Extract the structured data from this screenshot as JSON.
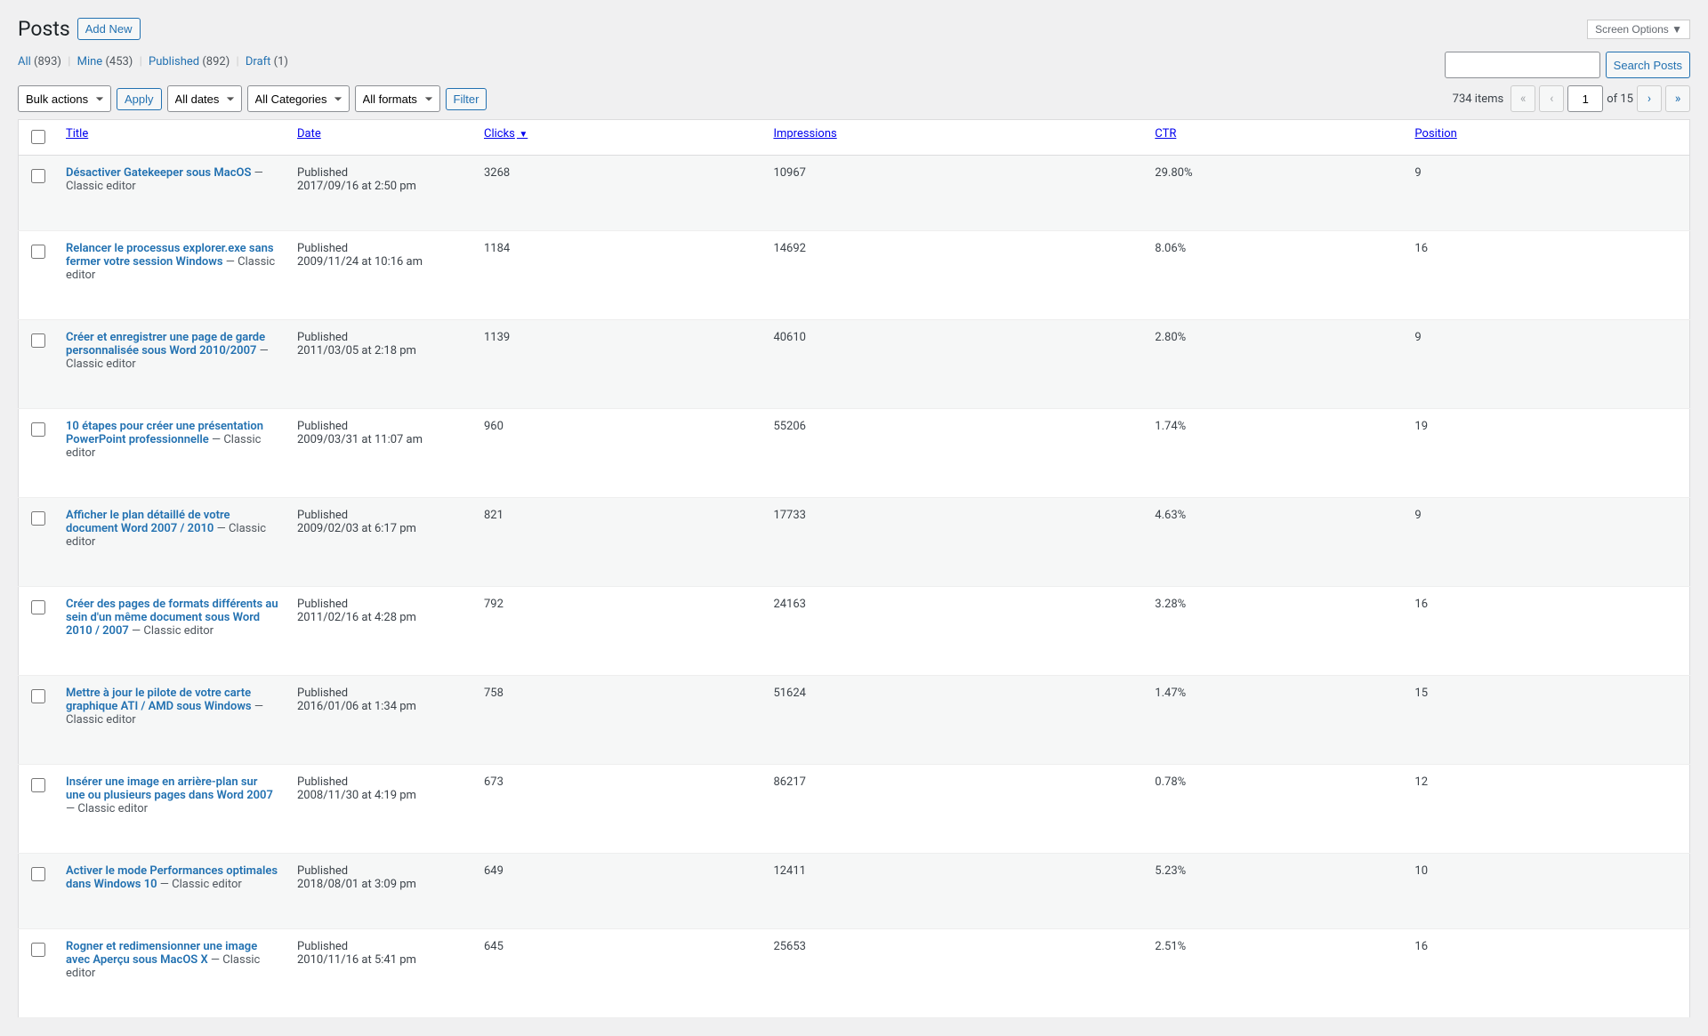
{
  "header": {
    "title": "Posts",
    "add_new": "Add New",
    "screen_options": "Screen Options ▼"
  },
  "subsub": {
    "all_label": "All",
    "all_count": "(893)",
    "mine_label": "Mine",
    "mine_count": "(453)",
    "published_label": "Published",
    "published_count": "(892)",
    "draft_label": "Draft",
    "draft_count": "(1)"
  },
  "search": {
    "button": "Search Posts"
  },
  "filters": {
    "bulk": "Bulk actions",
    "apply": "Apply",
    "dates": "All dates",
    "categories": "All Categories",
    "formats": "All formats",
    "filter": "Filter"
  },
  "pagination": {
    "items_label": "734 items",
    "current": "1",
    "of_label": "of 15"
  },
  "columns": {
    "title": "Title",
    "date": "Date",
    "clicks": "Clicks",
    "impressions": "Impressions",
    "ctr": "CTR",
    "position": "Position"
  },
  "editor_suffix": " — Classic editor",
  "status_published": "Published",
  "rows": [
    {
      "title": "Désactiver Gatekeeper sous MacOS",
      "date": "2017/09/16 at 2:50 pm",
      "clicks": "3268",
      "impressions": "10967",
      "ctr": "29.80%",
      "position": "9"
    },
    {
      "title": "Relancer le processus explorer.exe sans fermer votre session Windows",
      "date": "2009/11/24 at 10:16 am",
      "clicks": "1184",
      "impressions": "14692",
      "ctr": "8.06%",
      "position": "16"
    },
    {
      "title": "Créer et enregistrer une page de garde personnalisée sous Word 2010/2007",
      "date": "2011/03/05 at 2:18 pm",
      "clicks": "1139",
      "impressions": "40610",
      "ctr": "2.80%",
      "position": "9"
    },
    {
      "title": "10 étapes pour créer une présentation PowerPoint professionnelle",
      "date": "2009/03/31 at 11:07 am",
      "clicks": "960",
      "impressions": "55206",
      "ctr": "1.74%",
      "position": "19"
    },
    {
      "title": "Afficher le plan détaillé de votre document Word 2007 / 2010",
      "date": "2009/02/03 at 6:17 pm",
      "clicks": "821",
      "impressions": "17733",
      "ctr": "4.63%",
      "position": "9"
    },
    {
      "title": "Créer des pages de formats différents au sein d'un même document sous Word 2010 / 2007",
      "date": "2011/02/16 at 4:28 pm",
      "clicks": "792",
      "impressions": "24163",
      "ctr": "3.28%",
      "position": "16"
    },
    {
      "title": "Mettre à jour le pilote de votre carte graphique ATI / AMD sous Windows",
      "date": "2016/01/06 at 1:34 pm",
      "clicks": "758",
      "impressions": "51624",
      "ctr": "1.47%",
      "position": "15"
    },
    {
      "title": "Insérer une image en arrière-plan sur une ou plusieurs pages dans Word 2007",
      "date": "2008/11/30 at 4:19 pm",
      "clicks": "673",
      "impressions": "86217",
      "ctr": "0.78%",
      "position": "12"
    },
    {
      "title": "Activer le mode Performances optimales dans Windows 10",
      "date": "2018/08/01 at 3:09 pm",
      "clicks": "649",
      "impressions": "12411",
      "ctr": "5.23%",
      "position": "10"
    },
    {
      "title": "Rogner et redimensionner une image avec Aperçu sous MacOS X",
      "date": "2010/11/16 at 5:41 pm",
      "clicks": "645",
      "impressions": "25653",
      "ctr": "2.51%",
      "position": "16"
    }
  ]
}
